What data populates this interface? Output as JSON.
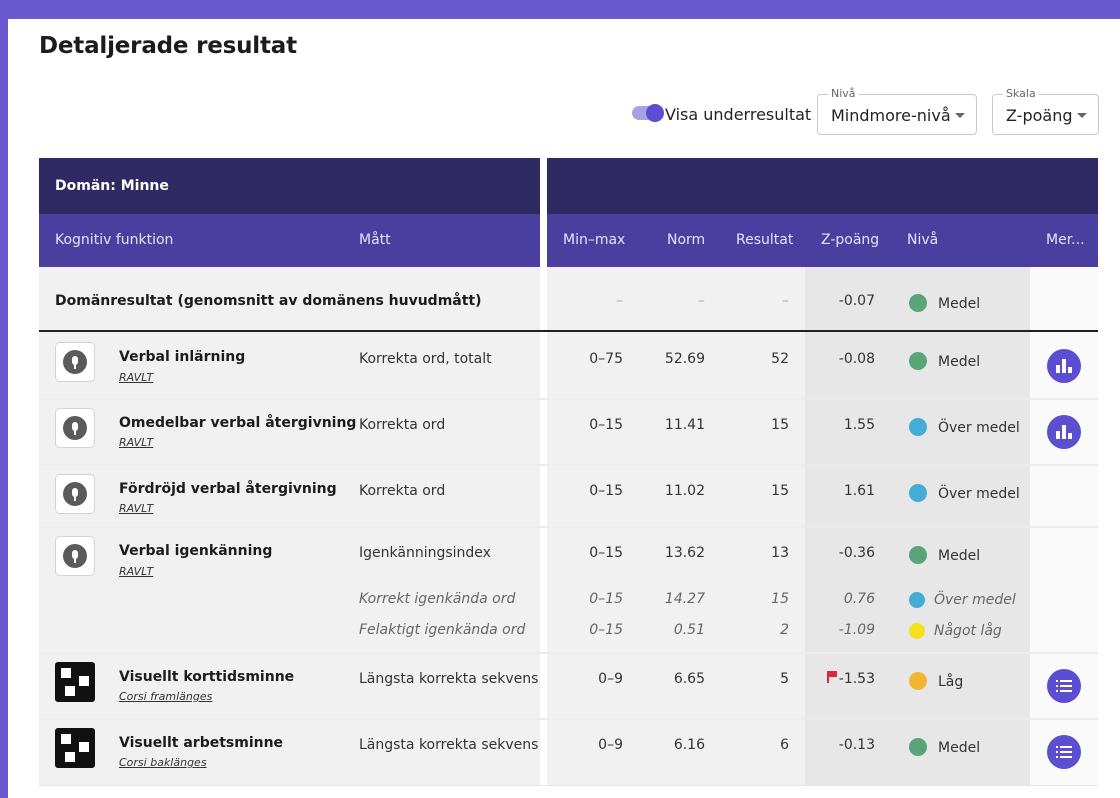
{
  "page": {
    "title": "Detaljerade resultat",
    "background_color": "#6a5acd"
  },
  "controls": {
    "toggle_label": "Visa underresultat",
    "toggle_on": true,
    "level_select": {
      "label": "Nivå",
      "value": "Mindmore-nivå"
    },
    "scale_select": {
      "label": "Skala",
      "value": "Z-poäng"
    }
  },
  "table": {
    "domain_header": "Domän: Minne",
    "columns": {
      "function": "Kognitiv funktion",
      "measure": "Mått",
      "minmax": "Min–max",
      "norm": "Norm",
      "result": "Resultat",
      "z": "Z-poäng",
      "level": "Nivå",
      "more": "Mer..."
    },
    "domain_row": {
      "label": "Domänresultat (genomsnitt av domänens huvudmått)",
      "minmax": "–",
      "norm": "–",
      "result": "–",
      "z": "-0.07",
      "level": "Medel",
      "level_color": "#5aa577"
    },
    "rows": [
      {
        "name": "Verbal inlärning",
        "test": "RAVLT",
        "icon": "microphone-icon",
        "measure": "Korrekta ord, totalt",
        "minmax": "0–75",
        "norm": "52.69",
        "result": "52",
        "z": "-0.08",
        "level": "Medel",
        "level_color": "#5aa577",
        "more": "bar-chart-icon"
      },
      {
        "name": "Omedelbar verbal återgivning",
        "test": "RAVLT",
        "icon": "microphone-icon",
        "measure": "Korrekta ord",
        "minmax": "0–15",
        "norm": "11.41",
        "result": "15",
        "z": "1.55",
        "level": "Över medel",
        "level_color": "#45acd6",
        "more": "bar-chart-icon"
      },
      {
        "name": "Fördröjd verbal återgivning",
        "test": "RAVLT",
        "icon": "microphone-icon",
        "measure": "Korrekta ord",
        "minmax": "0–15",
        "norm": "11.02",
        "result": "15",
        "z": "1.61",
        "level": "Över medel",
        "level_color": "#45acd6"
      },
      {
        "name": "Verbal igenkänning",
        "test": "RAVLT",
        "icon": "microphone-icon",
        "measure": "Igenkänningsindex",
        "minmax": "0–15",
        "norm": "13.62",
        "result": "13",
        "z": "-0.36",
        "level": "Medel",
        "level_color": "#5aa577",
        "subrows": [
          {
            "measure": "Korrekt igenkända ord",
            "minmax": "0–15",
            "norm": "14.27",
            "result": "15",
            "z": "0.76",
            "level": "Över medel",
            "level_color": "#45acd6"
          },
          {
            "measure": "Felaktigt igenkända ord",
            "minmax": "0–15",
            "norm": "0.51",
            "result": "2",
            "z": "-1.09",
            "level": "Något låg",
            "level_color": "#f5e21c"
          }
        ]
      },
      {
        "name": "Visuellt korttidsminne",
        "test": "Corsi framlänges",
        "icon": "corsi-block-icon",
        "measure": "Längsta korrekta sekvens",
        "minmax": "0–9",
        "norm": "6.65",
        "result": "5",
        "z": "-1.53",
        "z_flag": true,
        "level": "Låg",
        "level_color": "#f2b632",
        "more": "list-icon"
      },
      {
        "name": "Visuellt arbetsminne",
        "test": "Corsi baklänges",
        "icon": "corsi-block-icon",
        "measure": "Längsta korrekta sekvens",
        "minmax": "0–9",
        "norm": "6.16",
        "result": "6",
        "z": "-0.13",
        "level": "Medel",
        "level_color": "#5aa577",
        "more": "list-icon"
      }
    ]
  }
}
